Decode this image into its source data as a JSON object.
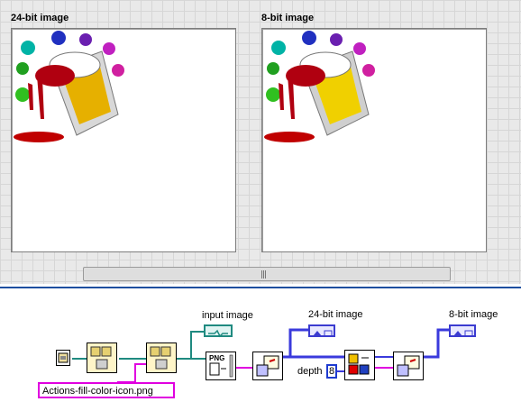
{
  "front_panel": {
    "left_indicator_label": "24-bit image",
    "right_indicator_label": "8-bit image"
  },
  "block_diagram": {
    "input_image_label": "input image",
    "out24_label": "24-bit image",
    "out8_label": "8-bit image",
    "depth_label": "depth",
    "depth_value": "8",
    "path_value": "Actions-fill-color-icon.png",
    "png_label": "PNG"
  },
  "colors": {
    "wire_blue": "#3a3adc",
    "wire_teal": "#1f8a80",
    "wire_pink": "#e000e0",
    "divider": "#1e4fa0"
  }
}
